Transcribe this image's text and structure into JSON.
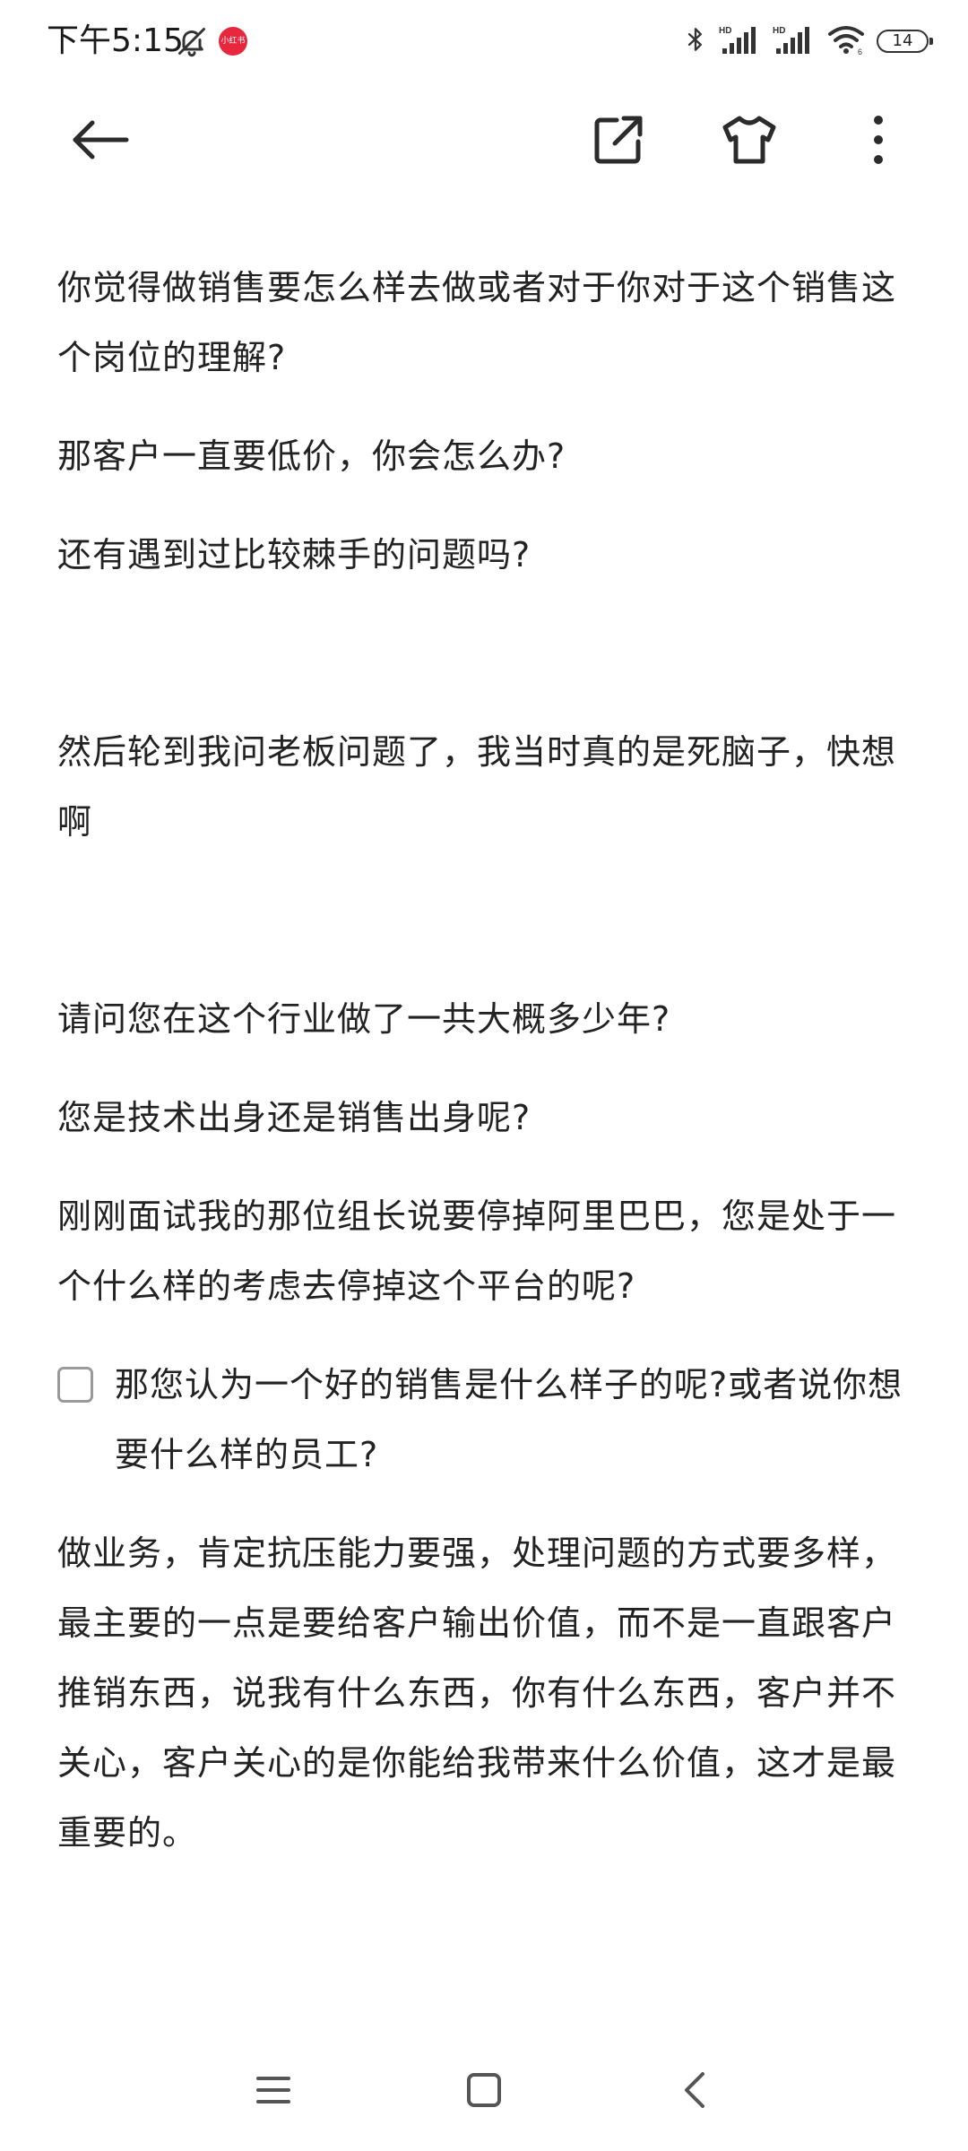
{
  "status_bar": {
    "time": "下午5:15",
    "app_badge": "小红书",
    "battery": "14"
  },
  "app_bar": {
    "icons": [
      "back-arrow-icon",
      "share-icon",
      "shirt-icon",
      "more-vert-icon"
    ]
  },
  "document": {
    "paragraphs_block1": [
      "你觉得做销售要怎么样去做或者对于你对于这个销售这个岗位的理解?",
      "那客户一直要低价，你会怎么办?",
      "还有遇到过比较棘手的问题吗?"
    ],
    "paragraph_block2": "然后轮到我问老板问题了，我当时真的是死脑子，快想啊",
    "paragraphs_block3": [
      "请问您在这个行业做了一共大概多少年?",
      "您是技术出身还是销售出身呢?",
      "刚刚面试我的那位组长说要停掉阿里巴巴，您是处于一个什么样的考虑去停掉这个平台的呢?"
    ],
    "todo": {
      "checked": false,
      "text": "那您认为一个好的销售是什么样子的呢?或者说你想要什么样的员工?"
    },
    "final_paragraph": "做业务，肯定抗压能力要强，处理问题的方式要多样，最主要的一点是要给客户输出价值，而不是一直跟客户推销东西，说我有什么东西，你有什么东西，客户并不关心，客户关心的是你能给我带来什么价值，这才是最重要的。"
  },
  "colors": {
    "text": "#222222",
    "background": "#ffffff",
    "badge": "#e6273e",
    "icon": "#333333"
  }
}
